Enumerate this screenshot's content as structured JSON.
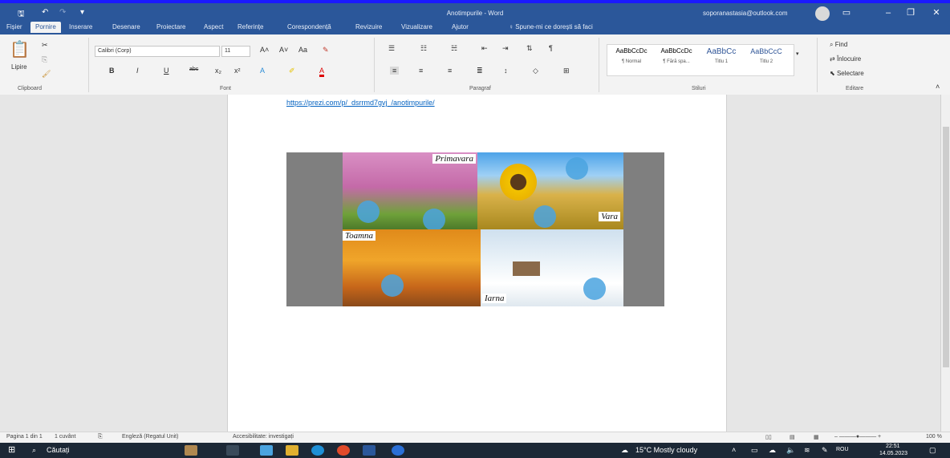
{
  "window": {
    "title": "Anotimpurile - Word",
    "account": "soporanastasia@outlook.com"
  },
  "tabs": [
    "Fișier",
    "Pornire",
    "Inserare",
    "Desenare",
    "Proiectare",
    "Aspect",
    "Referințe",
    "Corespondență",
    "Revizuire",
    "Vizualizare",
    "Ajutor"
  ],
  "tell_me": "Spune-mi ce dorești să faci",
  "ribbon": {
    "clipboard": {
      "paste_label": "Lipire",
      "group": "Clipboard"
    },
    "font": {
      "name": "Calibri (Corp)",
      "size": "11",
      "group": "Font"
    },
    "paragraph": {
      "group": "Paragraf"
    },
    "styles": {
      "group": "Stiluri",
      "items": [
        {
          "preview": "AaBbCcDc",
          "name": "¶ Normal"
        },
        {
          "preview": "AaBbCcDc",
          "name": "¶ Fără spa..."
        },
        {
          "preview": "AaBbCc",
          "name": "Titlu 1"
        },
        {
          "preview": "AaBbCcC",
          "name": "Titlu 2"
        }
      ]
    },
    "editing": {
      "group": "Editare",
      "find": "Find",
      "replace": "Înlocuire",
      "select": "Selectare"
    }
  },
  "document": {
    "link": "https://prezi.com/p/_dsrrmd7gvj_/anotimpurile/",
    "seasons": {
      "spring": "Primavara",
      "summer": "Vara",
      "autumn": "Toamna",
      "winter": "Iarna"
    }
  },
  "status": {
    "page": "Pagina 1 din 1",
    "words": "1 cuvânt",
    "language": "Engleză (Regatul Unit)",
    "accessibility": "Accesibilitate: investigați",
    "zoom": "100 %"
  },
  "taskbar": {
    "search": "Căutați",
    "weather": "15°C  Mostly cloudy",
    "lang": "ROU",
    "time": "22:51",
    "date": "14.05.2023"
  }
}
